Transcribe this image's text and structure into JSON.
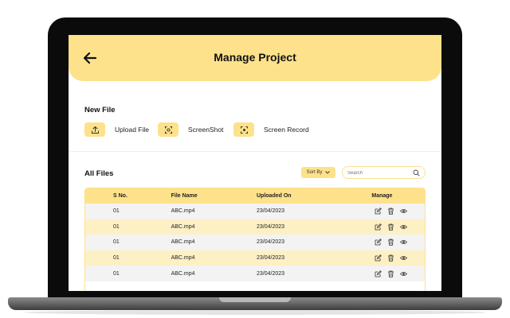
{
  "header": {
    "title": "Manage Project",
    "back_icon": "arrow-left-icon"
  },
  "new_file": {
    "title": "New File",
    "actions": [
      {
        "label": "Upload File",
        "icon": "upload-icon"
      },
      {
        "label": "ScreenShot",
        "icon": "screenshot-icon"
      },
      {
        "label": "Screen Record",
        "icon": "screen-record-icon"
      }
    ]
  },
  "all_files": {
    "title": "All Files",
    "sort_label": "Sort By",
    "search_placeholder": "Search"
  },
  "table": {
    "columns": [
      "S No.",
      "File Name",
      "Uploaded On",
      "Manage"
    ],
    "rows": [
      {
        "sno": "01",
        "file_name": "ABC.mp4",
        "uploaded_on": "23/04/2023"
      },
      {
        "sno": "01",
        "file_name": "ABC.mp4",
        "uploaded_on": "23/04/2023"
      },
      {
        "sno": "01",
        "file_name": "ABC.mp4",
        "uploaded_on": "23/04/2023"
      },
      {
        "sno": "01",
        "file_name": "ABC.mp4",
        "uploaded_on": "23/04/2023"
      },
      {
        "sno": "01",
        "file_name": "ABC.mp4",
        "uploaded_on": "23/04/2023"
      }
    ],
    "row_actions": [
      "edit-icon",
      "delete-icon",
      "view-icon"
    ]
  },
  "colors": {
    "accent": "#fde28b",
    "row_alt": "#fdf0c4",
    "row_base": "#f3f3f3",
    "bezel": "#0b0b0b"
  }
}
